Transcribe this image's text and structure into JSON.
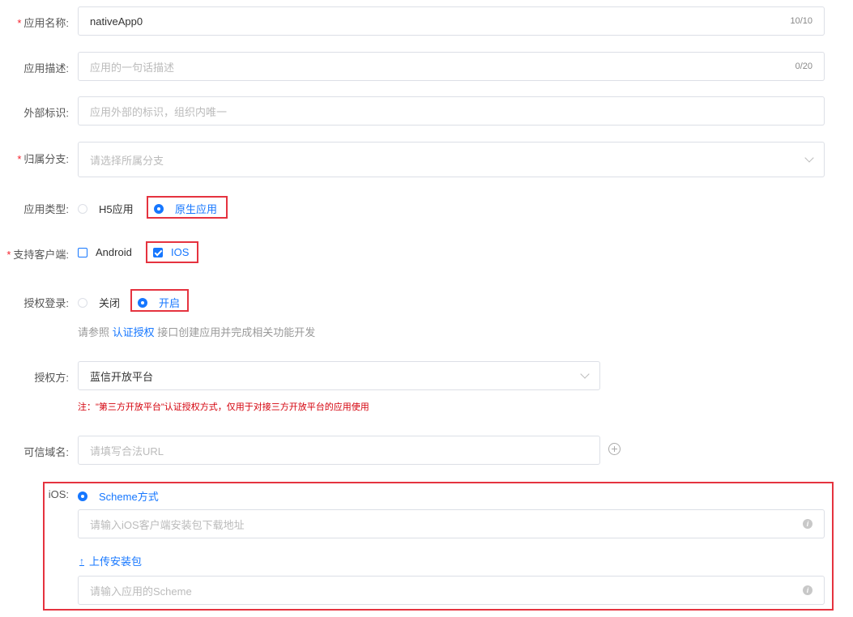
{
  "form": {
    "app_name": {
      "label": "应用名称:",
      "value": "nativeApp0",
      "count": "10/10"
    },
    "app_desc": {
      "label": "应用描述:",
      "placeholder": "应用的一句话描述",
      "count": "0/20"
    },
    "external_id": {
      "label": "外部标识:",
      "placeholder": "应用外部的标识，组织内唯一"
    },
    "branch": {
      "label": "归属分支:",
      "placeholder": "请选择所属分支"
    },
    "app_type": {
      "label": "应用类型:",
      "options": [
        "H5应用",
        "原生应用"
      ],
      "selected": "原生应用"
    },
    "clients": {
      "label": "支持客户端:",
      "options": [
        "Android",
        "IOS"
      ],
      "checked": [
        "IOS"
      ]
    },
    "auth_login": {
      "label": "授权登录:",
      "options": [
        "关闭",
        "开启"
      ],
      "selected": "开启",
      "hint_prefix": "请参照",
      "hint_link": "认证授权",
      "hint_suffix": "接口创建应用并完成相关功能开发"
    },
    "auth_provider": {
      "label": "授权方:",
      "value": "蓝信开放平台",
      "note": "注：\"第三方开放平台\"认证授权方式，仅用于对接三方开放平台的应用使用"
    },
    "trusted_domain": {
      "label": "可信域名:",
      "placeholder": "请填写合法URL"
    },
    "ios": {
      "label": "iOS:",
      "method": "Scheme方式",
      "download_placeholder": "请输入iOS客户端安装包下载地址",
      "upload_label": "上传安装包",
      "scheme_placeholder": "请输入应用的Scheme"
    }
  },
  "colors": {
    "primary": "#1677ff",
    "required": "#f5222d",
    "highlight": "#e5333f",
    "warning": "#d4000b"
  }
}
